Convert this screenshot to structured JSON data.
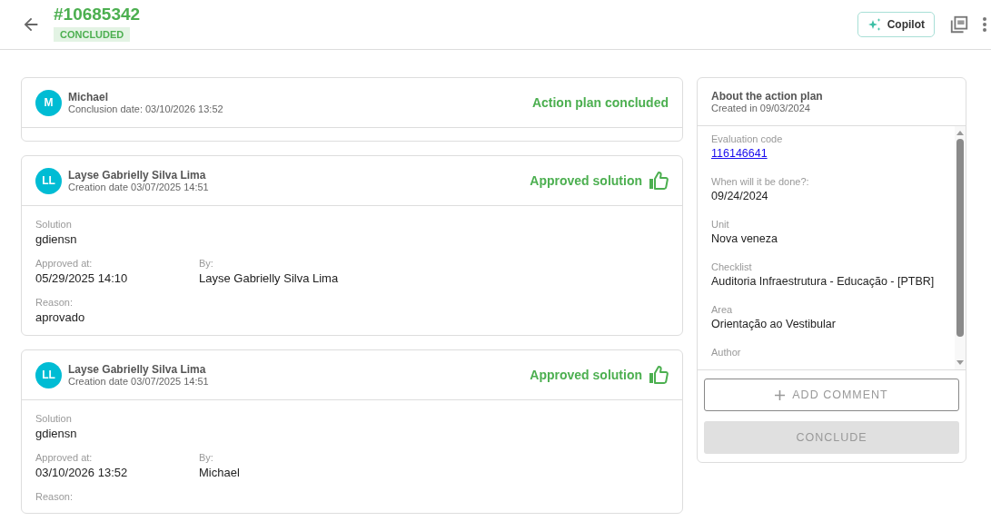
{
  "header": {
    "title": "#10685342",
    "status": "CONCLUDED",
    "copilot_label": "Copilot"
  },
  "events": [
    {
      "kind": "conclusion",
      "initials": "M",
      "author": "Michael",
      "date": "Conclusion date: 03/10/2026 13:52",
      "status": "Action plan concluded"
    },
    {
      "kind": "approval",
      "initials": "LL",
      "author": "Layse Gabrielly Silva Lima",
      "date": "Creation date 03/07/2025 14:51",
      "status": "Approved solution",
      "rows": [
        [
          {
            "label": "Solution",
            "value": "gdiensn"
          }
        ],
        [
          {
            "label": "Approved at:",
            "value": "05/29/2025 14:10"
          },
          {
            "label": "By:",
            "value": "Layse Gabrielly Silva Lima"
          }
        ],
        [
          {
            "label": "Reason:",
            "value": "aprovado"
          }
        ]
      ]
    },
    {
      "kind": "approval",
      "initials": "LL",
      "author": "Layse Gabrielly Silva Lima",
      "date": "Creation date 03/07/2025 14:51",
      "status": "Approved solution",
      "rows": [
        [
          {
            "label": "Solution",
            "value": "gdiensn"
          }
        ],
        [
          {
            "label": "Approved at:",
            "value": "03/10/2026 13:52"
          },
          {
            "label": "By:",
            "value": "Michael"
          }
        ],
        [
          {
            "label": "Reason:"
          }
        ]
      ]
    }
  ],
  "about": {
    "title": "About the action plan",
    "subtitle": "Created in 09/03/2024",
    "fields": [
      {
        "label": "Evaluation code",
        "value": "116146641",
        "kind": "link"
      },
      {
        "label": "When will it be done?:",
        "value": "09/24/2024",
        "kind": "text"
      },
      {
        "label": "Unit",
        "value": "Nova veneza",
        "kind": "text"
      },
      {
        "label": "Checklist",
        "value": "Auditoria Infraestrutura - Educação - [PTBR]",
        "kind": "text"
      },
      {
        "label": "Area",
        "value": "Orientação ao Vestibular",
        "kind": "text"
      },
      {
        "label": "Author"
      }
    ],
    "add_comment": "ADD COMMENT",
    "conclude": {
      "label": "CONCLUDE",
      "disabled": true
    }
  }
}
